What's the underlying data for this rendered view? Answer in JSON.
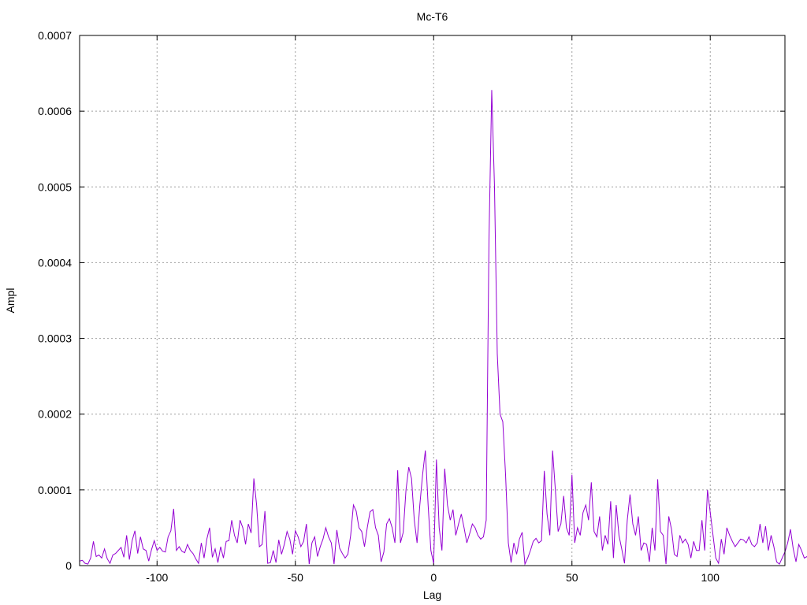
{
  "chart_data": {
    "type": "line",
    "title": "Mc-T6",
    "xlabel": "Lag",
    "ylabel": "Ampl",
    "xlim": [
      -128,
      127
    ],
    "ylim": [
      0,
      0.0007
    ],
    "x_ticks": [
      -100,
      -50,
      0,
      50,
      100
    ],
    "x_tick_labels": [
      "-100",
      "-50",
      "0",
      "50",
      "100"
    ],
    "y_ticks": [
      0,
      0.0001,
      0.0002,
      0.0003,
      0.0004,
      0.0005,
      0.0006,
      0.0007
    ],
    "y_tick_labels": [
      "0",
      "0.0001",
      "0.0002",
      "0.0003",
      "0.0004",
      "0.0005",
      "0.0006",
      "0.0007"
    ],
    "grid": true,
    "series": [
      {
        "color": "#9400d3",
        "x_start": -128,
        "x_step": 1,
        "values": [
          6e-06,
          7e-06,
          3e-06,
          2e-06,
          1e-05,
          3.2e-05,
          1.2e-05,
          1.4e-05,
          1e-05,
          2.2e-05,
          9e-06,
          3e-06,
          1.4e-05,
          1.6e-05,
          2e-05,
          2.4e-05,
          1.1e-05,
          4e-05,
          8e-06,
          3.3e-05,
          4.6e-05,
          1.6e-05,
          3.8e-05,
          2.2e-05,
          2e-05,
          6e-06,
          2.1e-05,
          3.3e-05,
          2e-05,
          2.4e-05,
          1.9e-05,
          1.8e-05,
          3.8e-05,
          4.6e-05,
          7.5e-05,
          2e-05,
          2.5e-05,
          1.9e-05,
          1.7e-05,
          2.8e-05,
          2e-05,
          1.6e-05,
          9e-06,
          3e-06,
          3e-05,
          1e-05,
          3.5e-05,
          5e-05,
          1.1e-05,
          2.2e-05,
          4e-06,
          2.5e-05,
          1e-05,
          3.2e-05,
          3.3e-05,
          6e-05,
          4e-05,
          3e-05,
          6e-05,
          5e-05,
          2.8e-05,
          5.5e-05,
          4.3e-05,
          0.000115,
          8e-05,
          2.5e-05,
          2.8e-05,
          7.2e-05,
          3e-06,
          4e-06,
          2e-05,
          4e-06,
          3.4e-05,
          1.5e-05,
          2.8e-05,
          4.5e-05,
          3.5e-05,
          1.5e-05,
          4.6e-05,
          3.8e-05,
          2.5e-05,
          3.2e-05,
          5.5e-05,
          2e-06,
          3e-05,
          3.8e-05,
          1.2e-05,
          2.5e-05,
          3.5e-05,
          5e-05,
          3.8e-05,
          3e-05,
          2e-06,
          4.7e-05,
          2.3e-05,
          1.6e-05,
          1e-05,
          1.5e-05,
          4e-05,
          8e-05,
          7.2e-05,
          5e-05,
          4.5e-05,
          2.5e-05,
          5e-05,
          7.1e-05,
          7.4e-05,
          5e-05,
          4e-05,
          5e-06,
          1.8e-05,
          5.5e-05,
          6.2e-05,
          5e-05,
          3e-05,
          0.000126,
          3e-05,
          4.4e-05,
          0.0001,
          0.00013,
          0.000115,
          6e-05,
          3e-05,
          8e-05,
          0.00012,
          0.000152,
          8e-05,
          2e-05,
          3e-06,
          0.00014,
          5e-05,
          2e-05,
          0.000128,
          8e-05,
          6e-05,
          7.4e-05,
          4e-05,
          5.5e-05,
          6.8e-05,
          5e-05,
          3e-05,
          4.2e-05,
          5.5e-05,
          5e-05,
          4e-05,
          3.5e-05,
          3.8e-05,
          6e-05,
          0.00043,
          0.000628,
          0.0005,
          0.00028,
          0.0002,
          0.00019,
          0.00012,
          3e-05,
          4e-06,
          3e-05,
          1.5e-05,
          3.5e-05,
          4.4e-05,
          2e-06,
          1e-05,
          2e-05,
          3.2e-05,
          3.6e-05,
          3e-05,
          3.3e-05,
          0.000125,
          6.8e-05,
          4e-05,
          0.000152,
          0.0001,
          4.5e-05,
          5.5e-05,
          9.2e-05,
          5e-05,
          4e-05,
          0.00012,
          3e-05,
          5e-05,
          4e-05,
          7e-05,
          8e-05,
          6e-05,
          0.00011,
          4.5e-05,
          3.8e-05,
          6.5e-05,
          2e-05,
          4e-05,
          2.8e-05,
          8.5e-05,
          1e-05,
          8e-05,
          4e-05,
          2.2e-05,
          3e-06,
          6e-05,
          9.4e-05,
          5.5e-05,
          4e-05,
          6.5e-05,
          2e-05,
          3e-05,
          2.8e-05,
          5e-06,
          5e-05,
          2e-05,
          0.000114,
          4.5e-05,
          4e-05,
          2e-06,
          6.5e-05,
          4.8e-05,
          1.5e-05,
          1.2e-05,
          4e-05,
          3e-05,
          3.5e-05,
          2.8e-05,
          1e-05,
          3.2e-05,
          2e-05,
          2e-05,
          6e-05,
          2e-05,
          0.0001,
          7e-05,
          4e-05,
          1e-05,
          3e-06,
          3.5e-05,
          1.5e-05,
          5e-05,
          4e-05,
          3.2e-05,
          2.5e-05,
          3e-05,
          3.5e-05,
          3.4e-05,
          3e-05,
          3.8e-05,
          2.8e-05,
          2.5e-05,
          3e-05,
          5.5e-05,
          3e-05,
          5.2e-05,
          2e-05,
          4e-05,
          2.5e-05,
          5e-06,
          2e-06,
          1e-05,
          1.8e-05,
          3e-05,
          4.8e-05,
          2.2e-05,
          5e-06,
          2.8e-05,
          2e-05,
          1e-05,
          1.2e-05,
          4e-06,
          2e-05,
          1.5e-05,
          1.7e-05,
          1.2e-05,
          2e-05,
          1.5e-05,
          2e-05,
          4e-05,
          1.2e-05,
          1.4e-05,
          4e-06,
          3e-06,
          3e-06,
          1.8e-05,
          5e-06,
          1.5e-05,
          1.2e-05,
          2e-05,
          3.8e-05,
          1.5e-05,
          2e-05,
          3e-05,
          1e-05,
          3e-05,
          1.2e-05,
          1e-05,
          2e-05,
          8e-06,
          3e-06,
          1.6e-05
        ]
      }
    ]
  }
}
